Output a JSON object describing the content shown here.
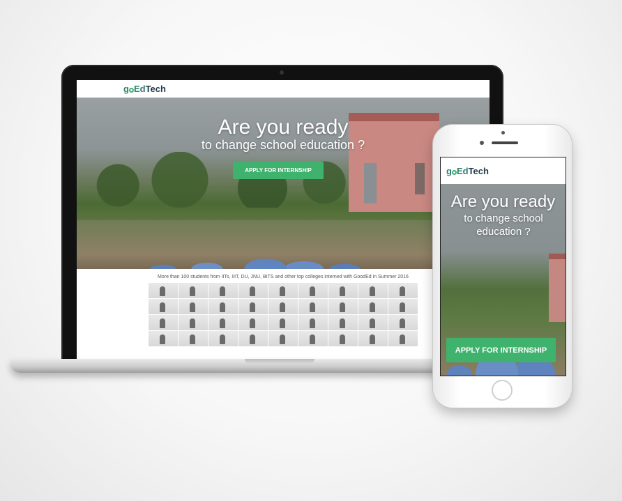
{
  "brand": {
    "go": "g",
    "o_icon": "ring-logo-icon",
    "rest_ed": "Ed",
    "rest_tech": "Tech"
  },
  "laptop": {
    "hero_title": "Are you ready",
    "hero_subtitle": "to change school education ?",
    "cta_label": "APPLY FOR INTERNSHIP",
    "caption": "More than 100 students from IITs, IIIT, DU, JNU, BITS and other top colleges interned with GoodEd in Summer 2016"
  },
  "phone": {
    "hero_title": "Are you ready",
    "hero_subtitle": "to change school education ?",
    "cta_label": "APPLY FOR INTERNSHIP"
  },
  "colors": {
    "accent": "#3fb36d",
    "logo_dark": "#1f3a4a",
    "logo_green": "#2f7f6e"
  }
}
